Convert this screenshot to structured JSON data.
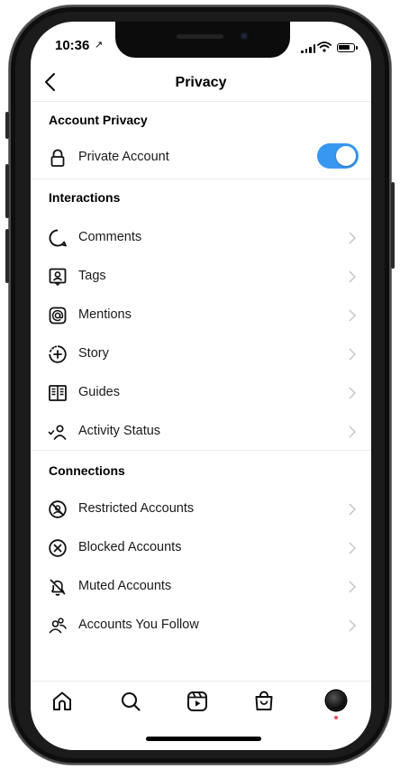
{
  "status_bar": {
    "time": "10:36"
  },
  "header": {
    "title": "Privacy"
  },
  "account_privacy": {
    "title": "Account Privacy",
    "private_account": {
      "label": "Private Account",
      "enabled": true
    }
  },
  "interactions": {
    "title": "Interactions",
    "items": [
      {
        "label": "Comments",
        "icon": "comment-icon"
      },
      {
        "label": "Tags",
        "icon": "tag-icon"
      },
      {
        "label": "Mentions",
        "icon": "mention-icon"
      },
      {
        "label": "Story",
        "icon": "story-add-icon"
      },
      {
        "label": "Guides",
        "icon": "guides-icon"
      },
      {
        "label": "Activity Status",
        "icon": "activity-status-icon"
      }
    ]
  },
  "connections": {
    "title": "Connections",
    "items": [
      {
        "label": "Restricted Accounts",
        "icon": "restricted-icon"
      },
      {
        "label": "Blocked Accounts",
        "icon": "blocked-icon"
      },
      {
        "label": "Muted Accounts",
        "icon": "muted-bell-icon"
      },
      {
        "label": "Accounts You Follow",
        "icon": "accounts-follow-icon"
      }
    ]
  },
  "tab_bar": {
    "items": [
      "home-icon",
      "search-icon",
      "reels-icon",
      "shop-icon",
      "profile-avatar"
    ]
  },
  "colors": {
    "accent": "#3897f0",
    "notification_dot": "#ed4956",
    "text": "#1a1a1a",
    "chevron": "#c7c7c7"
  }
}
